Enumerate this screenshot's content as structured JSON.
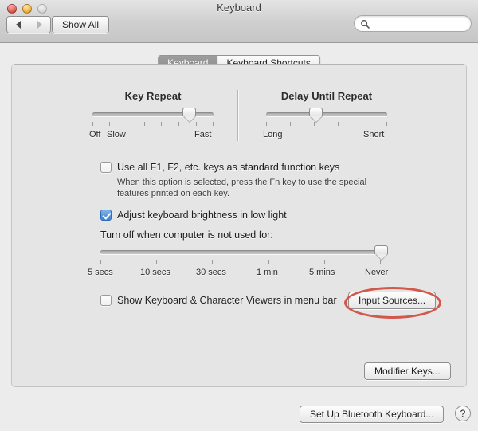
{
  "window": {
    "title": "Keyboard",
    "traffic_lights": [
      "close",
      "minimize",
      "zoom"
    ]
  },
  "toolbar": {
    "back_label": "back-arrow",
    "forward_label": "forward-arrow",
    "show_all_label": "Show All",
    "search": {
      "value": "",
      "placeholder": ""
    }
  },
  "tabs": [
    {
      "label": "Keyboard",
      "active": true
    },
    {
      "label": "Keyboard Shortcuts",
      "active": false
    }
  ],
  "key_repeat": {
    "title": "Key Repeat",
    "left_labels": [
      "Off",
      "Slow"
    ],
    "right_label": "Fast",
    "ticks": 8,
    "value_index": 6
  },
  "delay_until_repeat": {
    "title": "Delay Until Repeat",
    "left_label": "Long",
    "right_label": "Short",
    "ticks": 6,
    "value_index": 2
  },
  "function_keys": {
    "checked": false,
    "label": "Use all F1, F2, etc. keys as standard function keys",
    "help_line1": "When this option is selected, press the Fn key to use the special",
    "help_line2": "features printed on each key."
  },
  "brightness": {
    "checked": true,
    "label": "Adjust keyboard brightness in low light",
    "turn_off_label": "Turn off when computer is not used for:",
    "tick_labels": [
      "5 secs",
      "10 secs",
      "30 secs",
      "1 min",
      "5 mins",
      "Never"
    ],
    "value_index": 5
  },
  "viewers": {
    "checked": false,
    "label": "Show Keyboard & Character Viewers in menu bar",
    "input_sources_button": "Input Sources..."
  },
  "buttons": {
    "modifier_keys": "Modifier Keys...",
    "set_up_bluetooth": "Set Up Bluetooth Keyboard...",
    "help": "?"
  },
  "annotation": {
    "shape": "ellipse",
    "target": "Input Sources...",
    "color": "#d3584c"
  }
}
